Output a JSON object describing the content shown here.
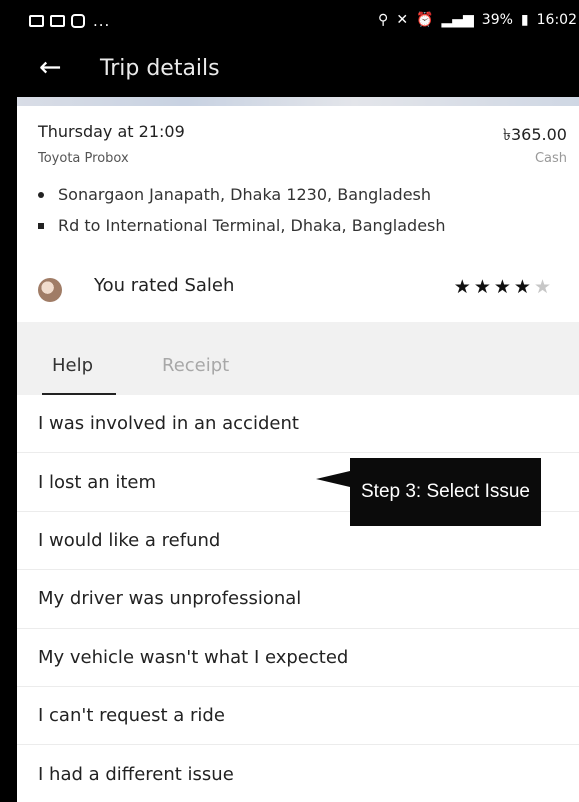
{
  "status_bar": {
    "left_icons": [
      "image-icon",
      "mail-icon",
      "instagram-icon"
    ],
    "dots": "...",
    "battery": "39%",
    "time": "16:02"
  },
  "app_bar": {
    "title": "Trip details"
  },
  "trip": {
    "date": "Thursday at 21:09",
    "price": "৳365.00",
    "car": "Toyota Probox",
    "payment": "Cash",
    "pickup": "Sonargaon Janapath, Dhaka 1230, Bangladesh",
    "dropoff": "Rd to International Terminal, Dhaka, Bangladesh"
  },
  "rating": {
    "text": "You rated Saleh",
    "stars_filled": 4,
    "stars_total": 5
  },
  "tabs": {
    "help": "Help",
    "receipt": "Receipt"
  },
  "issues": [
    {
      "label": "I was involved in an accident"
    },
    {
      "label": "I lost an item"
    },
    {
      "label": "I would like a refund"
    },
    {
      "label": "My driver was unprofessional"
    },
    {
      "label": "My vehicle wasn't what I expected"
    },
    {
      "label": "I can't request a ride"
    },
    {
      "label": "I had a different issue"
    }
  ],
  "callout": {
    "text": "Step 3: Select Issue"
  }
}
